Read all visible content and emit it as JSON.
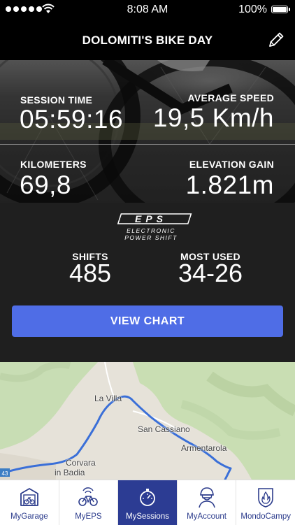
{
  "status_bar": {
    "time": "8:08 AM",
    "battery": "100%"
  },
  "header": {
    "title": "DOLOMITI'S BIKE DAY",
    "edit_icon": "pencil-icon"
  },
  "stats": {
    "session_time": {
      "label": "SESSION TIME",
      "value": "05:59:16"
    },
    "average_speed": {
      "label": "AVERAGE SPEED",
      "value": "19,5 Km/h"
    },
    "kilometers": {
      "label": "KILOMETERS",
      "value": "69,8"
    },
    "elevation_gain": {
      "label": "ELEVATION GAIN",
      "value": "1.821m"
    }
  },
  "eps": {
    "logo_text": "EPS",
    "logo_subtitle_1": "ELECTRONIC",
    "logo_subtitle_2": "POWER SHIFT",
    "shifts": {
      "label": "SHIFTS",
      "value": "485"
    },
    "most_used": {
      "label": "MOST USED",
      "value": "34-26"
    },
    "view_chart_label": "VIEW CHART"
  },
  "map": {
    "places": [
      "La Villa",
      "San Cassiano",
      "Armentarola",
      "Corvara",
      "in Badia"
    ],
    "road_badge": "43",
    "route_color": "#3a6fd8"
  },
  "tabs": [
    {
      "label": "MyGarage",
      "icon": "garage-icon",
      "active": false
    },
    {
      "label": "MyEPS",
      "icon": "bike-icon",
      "active": false
    },
    {
      "label": "MySessions",
      "icon": "stopwatch-icon",
      "active": true
    },
    {
      "label": "MyAccount",
      "icon": "rider-helmet-icon",
      "active": false
    },
    {
      "label": "MondoCampy",
      "icon": "campy-flame-icon",
      "active": false
    }
  ],
  "colors": {
    "accent": "#4f6de6",
    "tab_active": "#2c3c93",
    "tab_text": "#2c3c8c"
  }
}
